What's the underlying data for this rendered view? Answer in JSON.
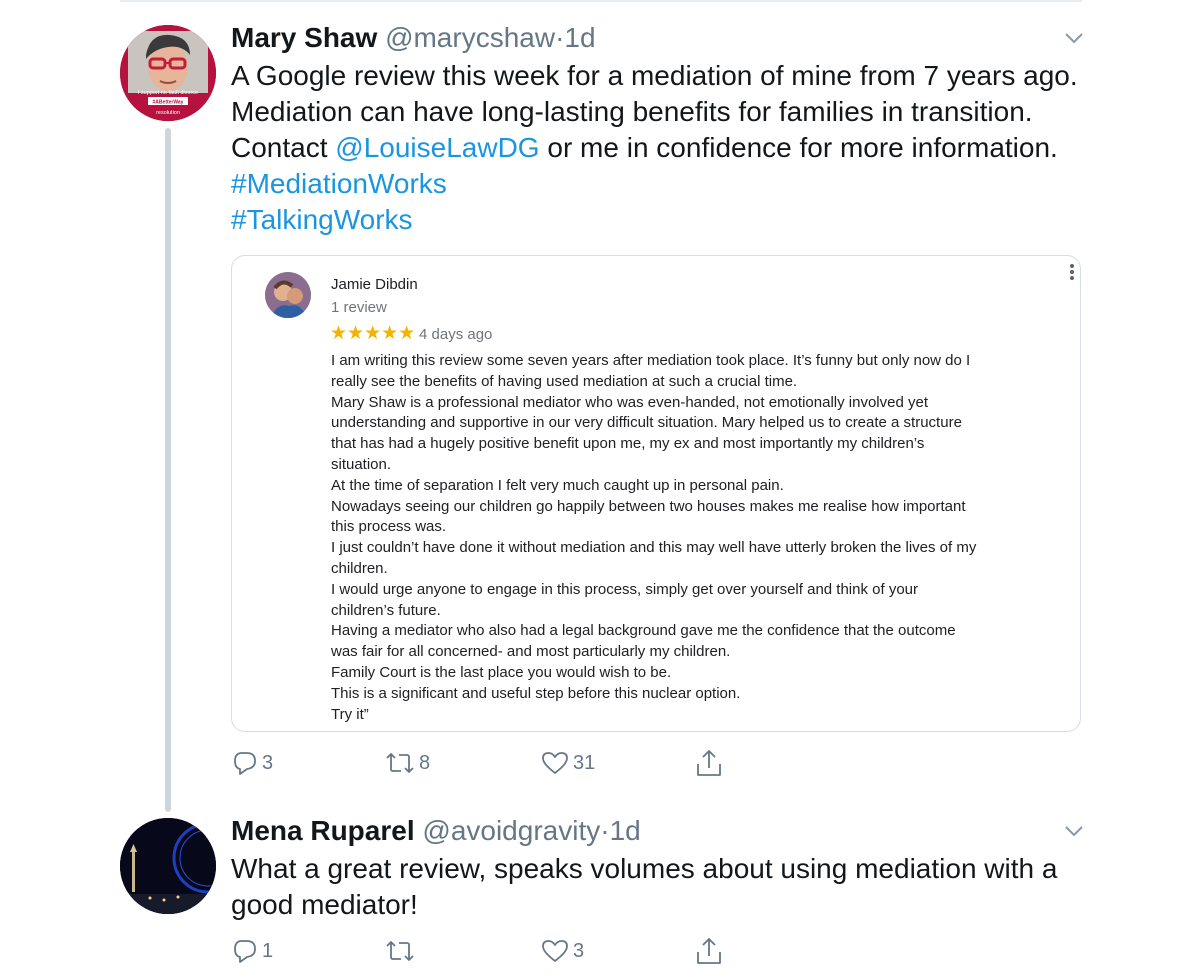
{
  "tweets": [
    {
      "name": "Mary Shaw",
      "handle": "@marycshaw",
      "separator": "·",
      "time": "1d",
      "text_lines": [
        [
          {
            "t": "A Google review this week for a mediation of mine from 7 years ago."
          }
        ],
        [
          {
            "t": "Mediation can have long-lasting benefits for families in transition."
          }
        ],
        [
          {
            "t": "Contact "
          },
          {
            "t": "@LouiseLawDG",
            "link": true
          },
          {
            "t": " or me in confidence for more information."
          }
        ],
        [
          {
            "t": "#MediationWorks",
            "link": true
          }
        ],
        [
          {
            "t": "#TalkingWorks",
            "link": true
          }
        ]
      ],
      "avatar": {
        "icon": "profile-photo-avatar",
        "badge_lines": [
          "I support no fault divorce",
          "#ABetterWay",
          "resolution"
        ]
      },
      "actions": {
        "reply": "3",
        "retweet": "8",
        "like": "31"
      }
    },
    {
      "name": "Mena Ruparel",
      "handle": "@avoidgravity",
      "separator": "·",
      "time": "1d",
      "text_lines": [
        [
          {
            "t": "What a great review, speaks volumes about using mediation with a"
          }
        ],
        [
          {
            "t": "good mediator!"
          }
        ]
      ],
      "avatar": {
        "icon": "night-city-photo-avatar"
      },
      "actions": {
        "reply": "1",
        "retweet": "",
        "like": "3"
      }
    }
  ],
  "review": {
    "reviewer": "Jamie Dibdin",
    "review_count": "1 review",
    "stars": "★★★★★",
    "rating": 5,
    "date": "4 days ago",
    "lines": [
      "I am writing this review some seven years after mediation took place. It’s funny but only now do I",
      "really see the benefits of having used mediation at such a crucial time.",
      "Mary Shaw is a  professional mediator who was even-handed, not emotionally involved yet",
      "understanding and supportive in our very difficult situation. Mary helped us to create a structure",
      "that has had a hugely positive benefit upon me, my ex and most importantly my children’s",
      "situation.",
      "At the time of separation I felt very much caught up in personal pain.",
      "Nowadays seeing our children go happily between two houses makes me realise how important",
      "this process was.",
      "I just couldn’t have done it without mediation and this may well have utterly broken the lives of my",
      "children.",
      "I would urge anyone to engage in this process, simply get over yourself and think of your",
      "children’s future.",
      "Having a mediator who also had a legal background gave me the confidence that the outcome",
      "was fair for all concerned- and most particularly my children.",
      "Family Court is the last place you would wish to be.",
      "This is a significant and useful step before this nuclear option.",
      "Try it”"
    ]
  },
  "colors": {
    "link": "#1b95e0",
    "muted": "#657786",
    "star": "#f2b400",
    "avatar_border": "#b5123f"
  },
  "icons": {
    "reply": "reply-icon",
    "retweet": "retweet-icon",
    "like": "heart-icon",
    "share": "share-icon",
    "menu": "chevron-down-icon",
    "card_menu": "more-vertical-icon"
  }
}
